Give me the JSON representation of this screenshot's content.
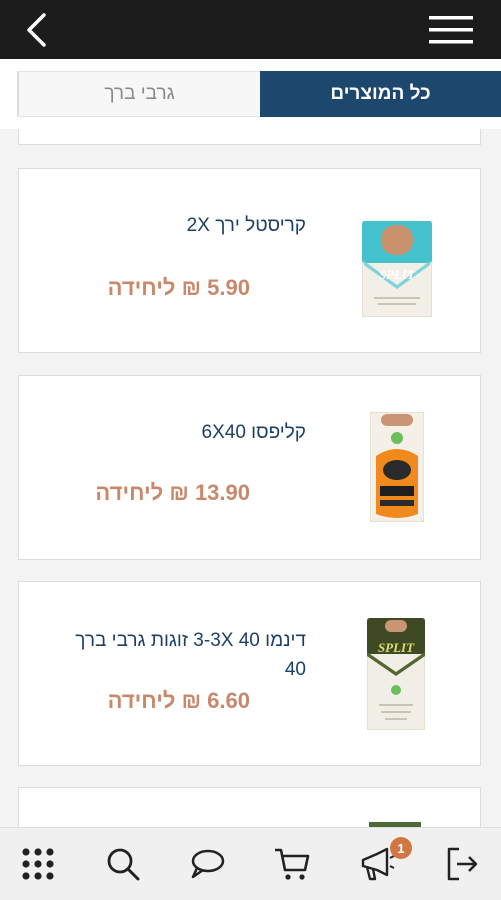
{
  "header": {
    "back_icon": "chevron-left-icon",
    "menu_icon": "hamburger-menu-icon"
  },
  "tabs": {
    "all_products": "כל המוצרים",
    "knee_socks": "גרבי ברך",
    "active": "all_products",
    "active_color": "#1d476d"
  },
  "products": [
    {
      "name": "קריסטל ירך 2X",
      "price": "5.90 ₪ ליחידה",
      "image": "crystal-pantyhose-box"
    },
    {
      "name": "קליפסו 6X40",
      "price": "13.90 ₪ ליחידה",
      "image": "calypso-pantyhose-box"
    },
    {
      "name": "דינמו 40 3-3X זוגות גרבי ברך 40",
      "price": "6.60 ₪ ליחידה",
      "image": "dynamo-knee-socks-box"
    }
  ],
  "colors": {
    "price": "#c9886a",
    "product_name": "#1d3f66",
    "badge": "#d07744"
  },
  "bottom_nav": {
    "items": [
      "grid-menu-icon",
      "search-icon",
      "chat-icon",
      "cart-icon",
      "megaphone-icon",
      "logout-icon"
    ],
    "notification_count": "1"
  }
}
